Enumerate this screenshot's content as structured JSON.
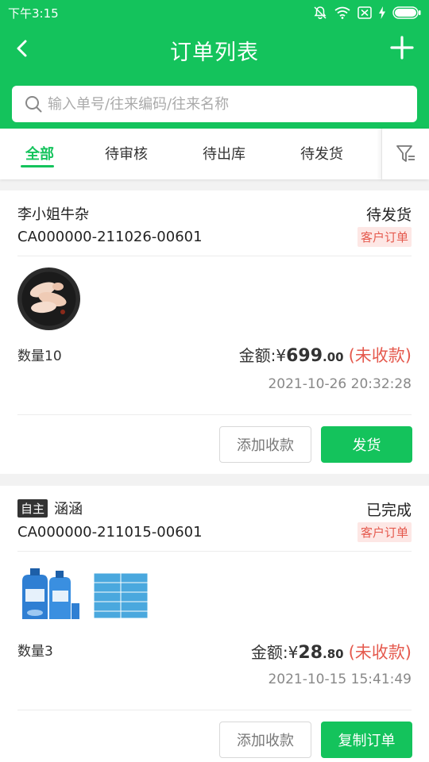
{
  "status_bar": {
    "time": "下午3:15"
  },
  "nav": {
    "title": "订单列表"
  },
  "search": {
    "placeholder": "输入单号/往来编码/往来名称"
  },
  "tabs": [
    {
      "label": "全部",
      "active": true
    },
    {
      "label": "待审核"
    },
    {
      "label": "待出库"
    },
    {
      "label": "待发货"
    }
  ],
  "orders": [
    {
      "customer": "李小姐牛杂",
      "order_no": "CA000000-211026-00601",
      "status": "待发货",
      "type_badge": "客户订单",
      "quantity": "数量10",
      "amount_label": "金额:",
      "currency": "¥",
      "amount_int": "699",
      "amount_dec": ".00",
      "payment_status": "(未收款)",
      "date": "2021-10-26 20:32:28",
      "secondary_button": "添加收款",
      "primary_button": "发货"
    },
    {
      "self_badge": "自主",
      "customer": "涵涵",
      "order_no": "CA000000-211015-00601",
      "status": "已完成",
      "type_badge": "客户订单",
      "quantity": "数量3",
      "amount_label": "金额:",
      "currency": "¥",
      "amount_int": "28",
      "amount_dec": ".80",
      "payment_status": "(未收款)",
      "date": "2021-10-15 15:41:49",
      "secondary_button": "添加收款",
      "primary_button": "复制订单"
    }
  ],
  "colors": {
    "brand": "#14c35c",
    "alert": "#e55a4e"
  }
}
